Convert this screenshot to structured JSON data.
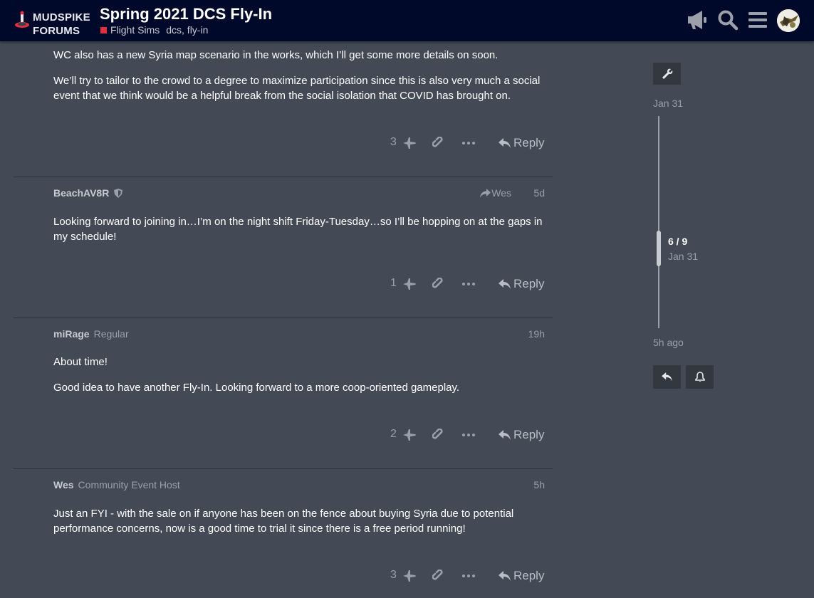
{
  "header": {
    "logo_line1": "MUDSPIKE",
    "logo_line2": "FORUMS",
    "title": "Spring 2021 DCS Fly-In",
    "category": "Flight Sims",
    "tags": "dcs, fly-in",
    "colors": {
      "bg": "#01092a",
      "category": "#e0303e"
    },
    "icons": [
      "megaphone-icon",
      "search-icon",
      "hamburger-menu-icon",
      "user-avatar"
    ]
  },
  "posts": [
    {
      "paragraphs": [
        "WC also has a new Syria map scenario in the works, which I’ll get some more details on soon.",
        "We’ll try to tailor to the crowd to a degree to maximize participation since this is also very much a social event that we think would be a helpful break from the social isolation that COVID has brought on."
      ],
      "likes": "3",
      "reply_label": "Reply"
    },
    {
      "username": "BeachAV8R",
      "reply_to": "Wes",
      "date": "5d",
      "paragraphs": [
        "Looking forward to joining in…I’m on the night shift Friday-Tuesday…so I’ll be hopping on at the gaps in my schedule!"
      ],
      "likes": "1",
      "reply_label": "Reply"
    },
    {
      "username": "miRage",
      "user_title": "Regular",
      "date": "19h",
      "paragraphs": [
        "About time!",
        "Good idea to have another Fly-In. Looking forward to a more coop-oriented gameplay."
      ],
      "likes": "2",
      "reply_label": "Reply"
    },
    {
      "username": "Wes",
      "user_title": "Community Event Host",
      "date": "5h",
      "paragraphs": [
        "Just an FYI - with the sale on if anyone has been on the fence about buying Syria due to potential performance concerns, now is a good time to trial it since there is a free period running!"
      ],
      "likes": "3",
      "reply_label": "Reply"
    }
  ],
  "timeline": {
    "start_date": "Jan 31",
    "position": "6 / 9",
    "position_date": "Jan 31",
    "end_label": "5h ago"
  }
}
